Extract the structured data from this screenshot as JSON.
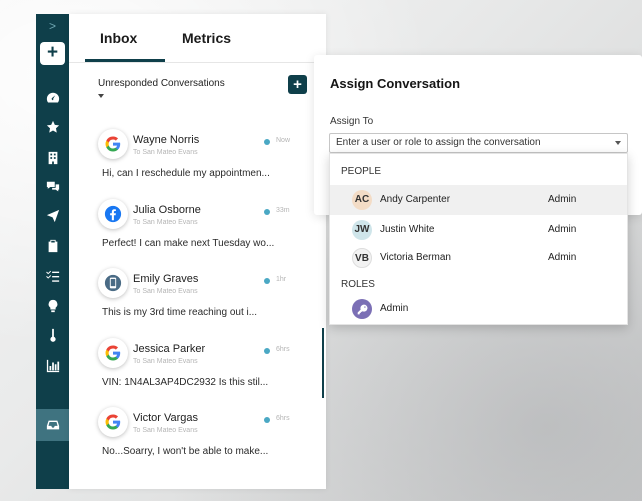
{
  "tabs": {
    "inbox": "Inbox",
    "metrics": "Metrics"
  },
  "filter": {
    "label": "Unresponded Conversations"
  },
  "compose": {
    "label": "+"
  },
  "sidebar": {
    "add_label": "+",
    "chevron": ">"
  },
  "conversations": [
    {
      "name": "Wayne Norris",
      "sub": "To San Mateo Evans",
      "time": "Now",
      "preview": "Hi, can I reschedule my appointmen...",
      "source": "google-icon"
    },
    {
      "name": "Julia Osborne",
      "sub": "To San Mateo Evans",
      "time": "33m",
      "preview": "Perfect! I can make next Tuesday wo...",
      "source": "facebook-icon"
    },
    {
      "name": "Emily Graves",
      "sub": "To San Mateo Evans",
      "time": "1hr",
      "preview": "This is my 3rd time reaching out i...",
      "source": "phone-icon"
    },
    {
      "name": "Jessica Parker",
      "sub": "To San Mateo Evans",
      "time": "6hrs",
      "preview": "VIN: 1N4AL3AP4DC2932 Is this stil...",
      "source": "google-icon"
    },
    {
      "name": "Victor Vargas",
      "sub": "To San Mateo Evans",
      "time": "6hrs",
      "preview": "No...Soarry, I won't be able to make...",
      "source": "google-icon"
    }
  ],
  "assign": {
    "title": "Assign Conversation",
    "label": "Assign To",
    "input_placeholder": "Enter a user or role to assign the conversation"
  },
  "dropdown": {
    "people_header": "PEOPLE",
    "roles_header": "ROLES",
    "people": [
      {
        "initials": "AC",
        "name": "Andy Carpenter",
        "role": "Admin",
        "color": "#f3dcc6"
      },
      {
        "initials": "JW",
        "name": "Justin White",
        "role": "Admin",
        "color": "#cfe5ea"
      },
      {
        "initials": "VB",
        "name": "Victoria Berman",
        "role": "Admin",
        "color": "#f2f2f2"
      }
    ],
    "roles": [
      {
        "name": "Admin"
      }
    ]
  },
  "colors": {
    "brand": "#0f3f4a",
    "accent_dot": "#4aa8c4",
    "role_icon": "#7b6fb5"
  }
}
